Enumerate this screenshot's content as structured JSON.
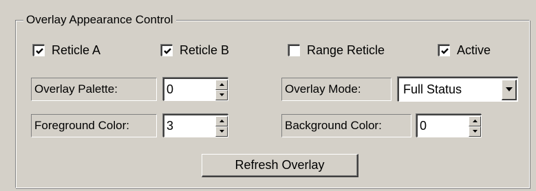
{
  "group": {
    "title": "Overlay Appearance Control"
  },
  "checkboxes": [
    {
      "label": "Reticle A",
      "checked": true
    },
    {
      "label": "Reticle B",
      "checked": true
    },
    {
      "label": "Range Reticle",
      "checked": false
    },
    {
      "label": "Active",
      "checked": true
    }
  ],
  "fields": {
    "overlay_palette": {
      "label": "Overlay Palette:",
      "value": "0"
    },
    "overlay_mode": {
      "label": "Overlay Mode:",
      "value": "Full Status"
    },
    "foreground_color": {
      "label": "Foreground Color:",
      "value": "3"
    },
    "background_color": {
      "label": "Background Color:",
      "value": "0"
    }
  },
  "buttons": {
    "refresh": "Refresh Overlay"
  },
  "icons": {
    "check": "check-mark-icon",
    "spin_up": "spin-up-arrow-icon",
    "spin_down": "spin-down-arrow-icon",
    "dropdown": "chevron-down-icon"
  },
  "colors": {
    "face": "#d4d0c8",
    "field": "#ffffff"
  }
}
